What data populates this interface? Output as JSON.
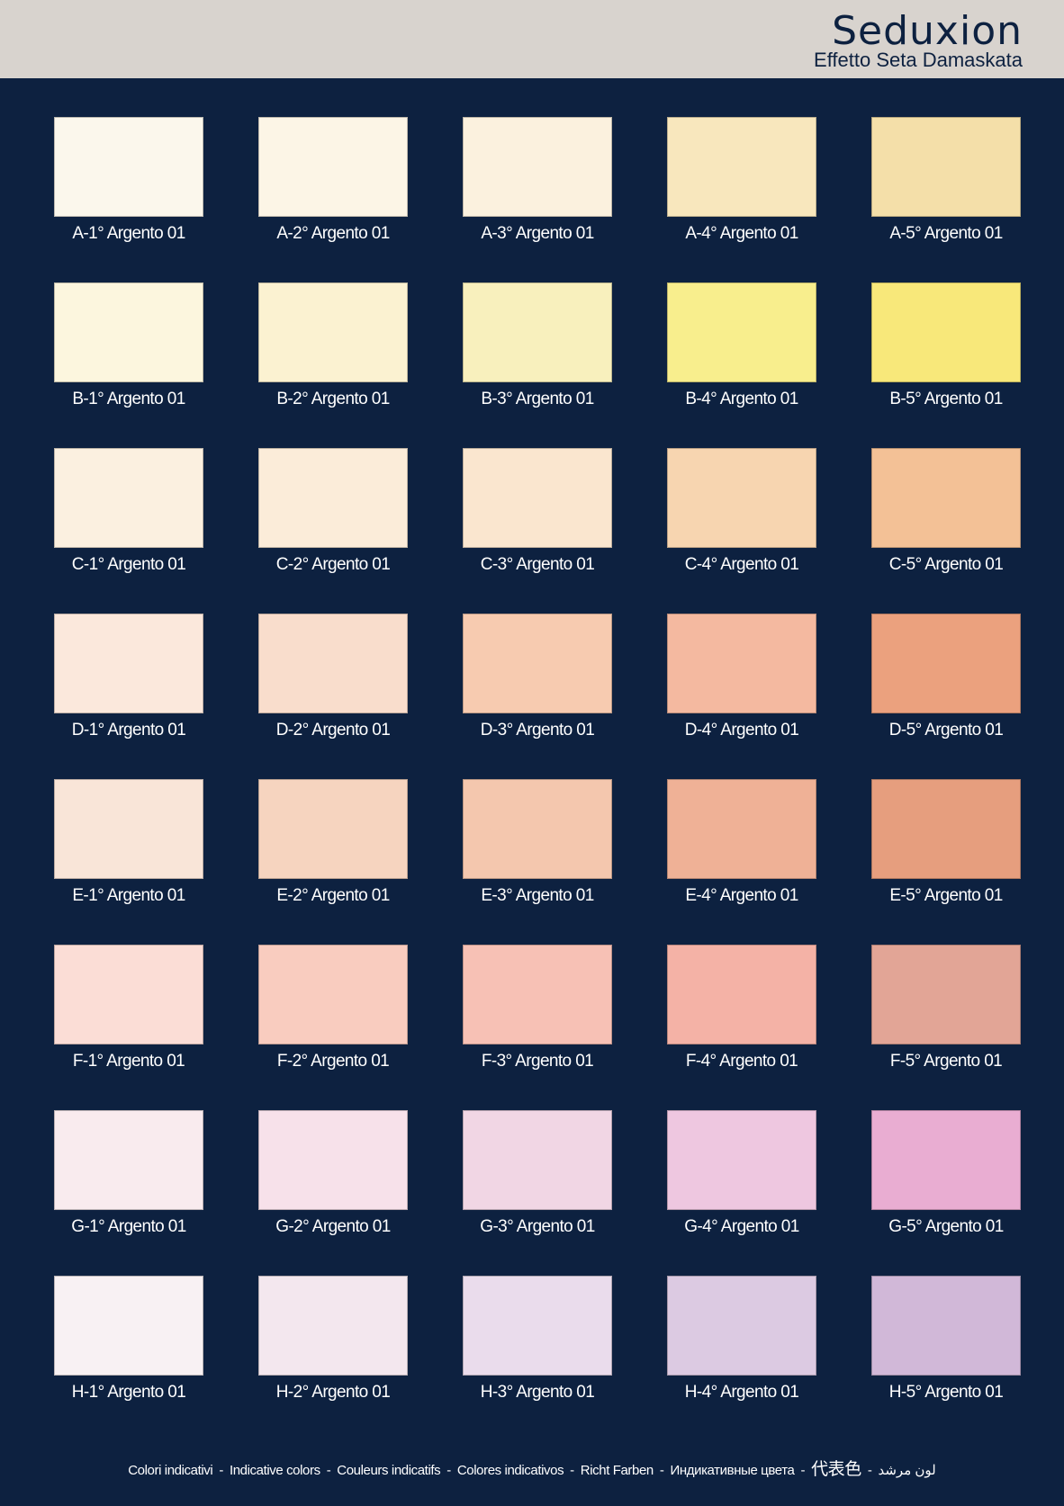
{
  "header": {
    "brand": "Seduxion",
    "subtitle": "Effetto Seta Damaskata"
  },
  "swatches": [
    [
      {
        "label": "A-1° Argento 01",
        "color": "#fbf7ec"
      },
      {
        "label": "A-2° Argento 01",
        "color": "#fcf5e6"
      },
      {
        "label": "A-3° Argento 01",
        "color": "#fbf1de"
      },
      {
        "label": "A-4° Argento 01",
        "color": "#f8e7bd"
      },
      {
        "label": "A-5° Argento 01",
        "color": "#f4dfa9"
      }
    ],
    [
      {
        "label": "B-1° Argento 01",
        "color": "#fcf6de"
      },
      {
        "label": "B-2° Argento 01",
        "color": "#fbf2d1"
      },
      {
        "label": "B-3° Argento 01",
        "color": "#f8f0bd"
      },
      {
        "label": "B-4° Argento 01",
        "color": "#f8ee8d"
      },
      {
        "label": "B-5° Argento 01",
        "color": "#f8e87a"
      }
    ],
    [
      {
        "label": "C-1° Argento 01",
        "color": "#fbf0e0"
      },
      {
        "label": "C-2° Argento 01",
        "color": "#fbecd9"
      },
      {
        "label": "C-3° Argento 01",
        "color": "#fae6cf"
      },
      {
        "label": "C-4° Argento 01",
        "color": "#f7d5b0"
      },
      {
        "label": "C-5° Argento 01",
        "color": "#f3c196"
      }
    ],
    [
      {
        "label": "D-1° Argento 01",
        "color": "#fbe8dc"
      },
      {
        "label": "D-2° Argento 01",
        "color": "#f9ddcc"
      },
      {
        "label": "D-3° Argento 01",
        "color": "#f7cbb0"
      },
      {
        "label": "D-4° Argento 01",
        "color": "#f4b9a0"
      },
      {
        "label": "D-5° Argento 01",
        "color": "#eba17e"
      }
    ],
    [
      {
        "label": "E-1° Argento 01",
        "color": "#f9e5d8"
      },
      {
        "label": "E-2° Argento 01",
        "color": "#f6d4bf"
      },
      {
        "label": "E-3° Argento 01",
        "color": "#f4c7ae"
      },
      {
        "label": "E-4° Argento 01",
        "color": "#efb196"
      },
      {
        "label": "E-5° Argento 01",
        "color": "#e69e7e"
      }
    ],
    [
      {
        "label": "F-1° Argento 01",
        "color": "#fbddd6"
      },
      {
        "label": "F-2° Argento 01",
        "color": "#f9ccbf"
      },
      {
        "label": "F-3° Argento 01",
        "color": "#f7c1b5"
      },
      {
        "label": "F-4° Argento 01",
        "color": "#f4b2a6"
      },
      {
        "label": "F-5° Argento 01",
        "color": "#e2a596"
      }
    ],
    [
      {
        "label": "G-1° Argento 01",
        "color": "#f9ebee"
      },
      {
        "label": "G-2° Argento 01",
        "color": "#f7e1ea"
      },
      {
        "label": "G-3° Argento 01",
        "color": "#f1d6e4"
      },
      {
        "label": "G-4° Argento 01",
        "color": "#eec7e0"
      },
      {
        "label": "G-5° Argento 01",
        "color": "#e9add2"
      }
    ],
    [
      {
        "label": "H-1° Argento 01",
        "color": "#f8f1f3"
      },
      {
        "label": "H-2° Argento 01",
        "color": "#f3e7ee"
      },
      {
        "label": "H-3° Argento 01",
        "color": "#eadcec"
      },
      {
        "label": "H-4° Argento 01",
        "color": "#dccae2"
      },
      {
        "label": "H-5° Argento 01",
        "color": "#d1b8d8"
      }
    ]
  ],
  "footer": {
    "items": [
      "Colori indicativi",
      "Indicative colors",
      "Couleurs indicatifs",
      "Colores indicativos",
      "Richt Farben",
      "Индикативные цвета",
      "代表色",
      "لون مرشد"
    ],
    "separator": "-"
  },
  "colors": {
    "background": "#0d2140",
    "header": "#d8d3ce",
    "text": "#ffffff"
  }
}
